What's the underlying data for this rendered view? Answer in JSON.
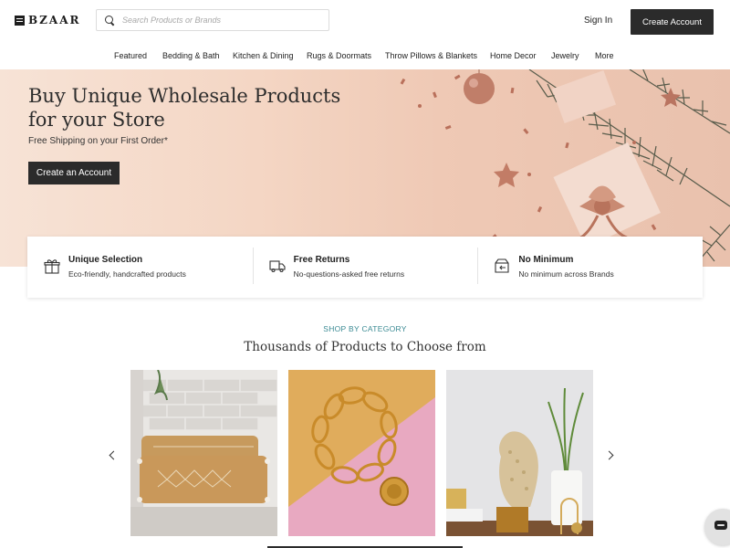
{
  "header": {
    "logo_text": "BZAAR",
    "search_placeholder": "Search Products or Brands",
    "sign_in": "Sign In",
    "create_account": "Create Account"
  },
  "nav": {
    "items": [
      "Featured",
      "Bedding & Bath",
      "Kitchen & Dining",
      "Rugs & Doormats",
      "Throw Pillows & Blankets",
      "Home Decor",
      "Jewelry",
      "More"
    ]
  },
  "hero": {
    "title": "Buy Unique Wholesale Products for your Store",
    "subtitle": "Free Shipping on your First Order*",
    "cta": "Create an Account"
  },
  "features": [
    {
      "icon": "gift-box-icon",
      "title": "Unique Selection",
      "desc": "Eco-friendly, handcrafted products"
    },
    {
      "icon": "delivery-truck-icon",
      "title": "Free Returns",
      "desc": "No-questions-asked free returns"
    },
    {
      "icon": "return-box-icon",
      "title": "No Minimum",
      "desc": "No minimum across Brands"
    }
  ],
  "category": {
    "label": "SHOP BY CATEGORY",
    "heading": "Thousands of Products to Choose from",
    "cards": [
      {
        "name": "throw-pillows-card",
        "image": "throw-pillows-image"
      },
      {
        "name": "jewelry-card",
        "image": "gold-bracelet-image"
      },
      {
        "name": "home-decor-card",
        "image": "decor-sculpture-image"
      }
    ]
  },
  "colors": {
    "dark_button": "#2b2b2b",
    "accent_teal": "#3a8a93",
    "hero_background": "#f4d6c4"
  }
}
